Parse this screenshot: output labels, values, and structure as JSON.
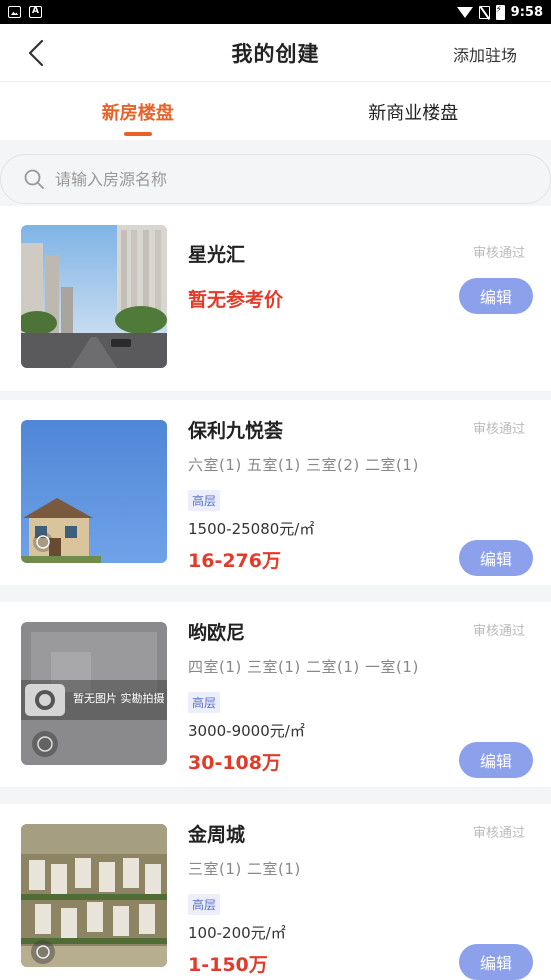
{
  "status_bar": {
    "time": "9:58"
  },
  "header": {
    "title": "我的创建",
    "add_label": "添加驻场"
  },
  "tabs": [
    {
      "label": "新房楼盘",
      "active": true
    },
    {
      "label": "新商业楼盘",
      "active": false
    }
  ],
  "search": {
    "placeholder": "请输入房源名称"
  },
  "listings": [
    {
      "name": "星光汇",
      "status": "审核通过",
      "price_text": "暂无参考价",
      "edit_label": "编辑"
    },
    {
      "name": "保利九悦荟",
      "status": "审核通过",
      "rooms": "六室(1) 五室(1) 三室(2) 二室(1)",
      "tag": "高层",
      "unit_price": "1500-25080元/㎡",
      "total_price": "16-276万",
      "edit_label": "编辑"
    },
    {
      "name": "哟欧尼",
      "status": "审核通过",
      "rooms": "四室(1) 三室(1) 二室(1) 一室(1)",
      "tag": "高层",
      "unit_price": "3000-9000元/㎡",
      "total_price": "30-108万",
      "edit_label": "编辑",
      "placeholder_text": "暂无图片 实勘拍摄中..."
    },
    {
      "name": "金周城",
      "status": "审核通过",
      "rooms": "三室(1) 二室(1)",
      "tag": "高层",
      "unit_price": "100-200元/㎡",
      "total_price": "1-150万",
      "edit_label": "编辑"
    }
  ],
  "icons": [
    "back-arrow-icon",
    "search-icon",
    "camera-icon",
    "lens-icon"
  ],
  "colors": {
    "accent": "#e9622a",
    "price": "#e23b2a",
    "edit_button": "#8ca0ec",
    "tag": "#5b6fc9"
  }
}
